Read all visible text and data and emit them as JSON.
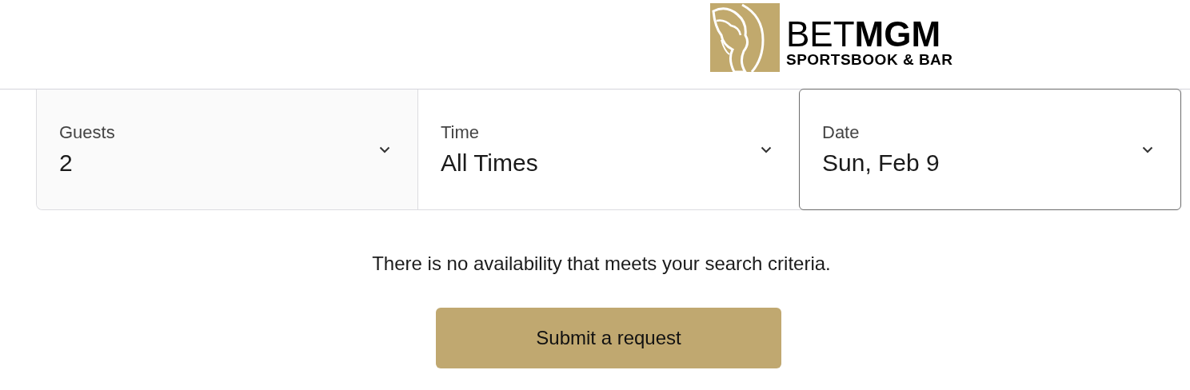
{
  "logo": {
    "wordmark": "BET**MGM**",
    "tagline": "SPORTSBOOK & BAR"
  },
  "filters": [
    {
      "label": "Guests",
      "value": "2",
      "selected": false
    },
    {
      "label": "Time",
      "value": "All Times",
      "selected": false
    },
    {
      "label": "Date",
      "value": "Sun, Feb 9",
      "selected": true
    }
  ],
  "message": "There is no availability that meets your search criteria.",
  "button": "Submit a request"
}
